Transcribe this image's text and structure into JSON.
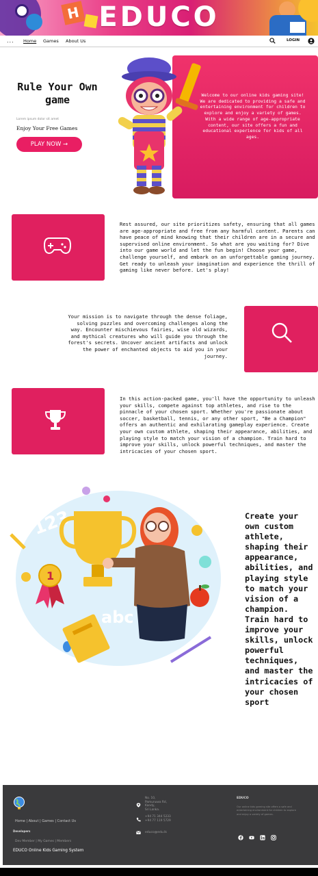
{
  "banner": {
    "title": "EDUCO"
  },
  "nav": {
    "menu_dots": "...",
    "links": [
      "Home",
      "Games",
      "About Us"
    ],
    "login": "LOGIN"
  },
  "hero": {
    "title": "Rule Your Own game",
    "small_text": "Lorem ipsum dolor sit amet",
    "subtitle": "Enjoy Your Free Games",
    "button": "PLAY NOW →",
    "panel_text": "Welcome to our online kids gaming site! We are dedicated to providing a safe and entertaining environment for children to explore and enjoy a variety of games. With a wide range of age-appropriate content, our site offers a fun and educational experience for kids of all ages."
  },
  "features": [
    {
      "icon": "gamepad-icon",
      "text": "Rest assured, our site prioritizes safety, ensuring that all games are age-appropriate and free from any harmful content. Parents can have peace of mind knowing that their children are in a secure and supervised online environment. So what are you waiting for? Dive into our game world and let the fun begin! Choose your game, challenge yourself, and embark on an unforgettable gaming journey. Get ready to unleash your imagination and experience the thrill of gaming like never before. Let's play!"
    },
    {
      "icon": "search-icon",
      "text": "Your mission is to navigate through the dense foliage, solving puzzles and overcoming challenges along the way. Encounter mischievous fairies, wise old wizards, and mythical creatures who will guide you through the forest's secrets. Uncover ancient artifacts and unlock the power of enchanted objects to aid you in your journey."
    },
    {
      "icon": "trophy-icon",
      "text": "In this action-packed game, you'll have the opportunity to unleash your skills, compete against top athletes, and rise to the pinnacle of your chosen sport. Whether you're passionate about soccer, basketball, tennis, or any other sport, \"Be a Champion\" offers an authentic and exhilarating gameplay experience. Create your own custom athlete, shaping their appearance, abilities, and playing style to match your vision of a champion. Train hard to improve your skills, unlock powerful techniques, and master the intricacies of your chosen sport."
    }
  ],
  "champion": {
    "text": "Create your own custom athlete, shaping their appearance, abilities, and playing style to match your vision of a champion. Train hard to improve your skills, unlock powerful techniques, and master the intricacies of your chosen sport",
    "art_labels": {
      "numbers": "123",
      "letters": "abc",
      "medal": "1"
    }
  },
  "footer": {
    "links": "Home | About | Games | Contact Us",
    "developers_label": "Developers",
    "developers": "Dev Member | My Games | Members",
    "tagline": "EDUCO Online Kids Gaming System",
    "address": [
      "No. 10,",
      "Pamunuwa Rd,",
      "Kandy,",
      "Sri Lanka."
    ],
    "phone": [
      "+94 71 344 5233",
      "+94 77 119 5729"
    ],
    "email": "educo@edu.lk",
    "brand": "EDUCO",
    "about": "Our online kids gaming site offers a safe and entertaining environment for children to explore and enjoy a variety of games."
  },
  "colors": {
    "accent": "#e0205f",
    "footer_bg": "#3a3a3c"
  }
}
